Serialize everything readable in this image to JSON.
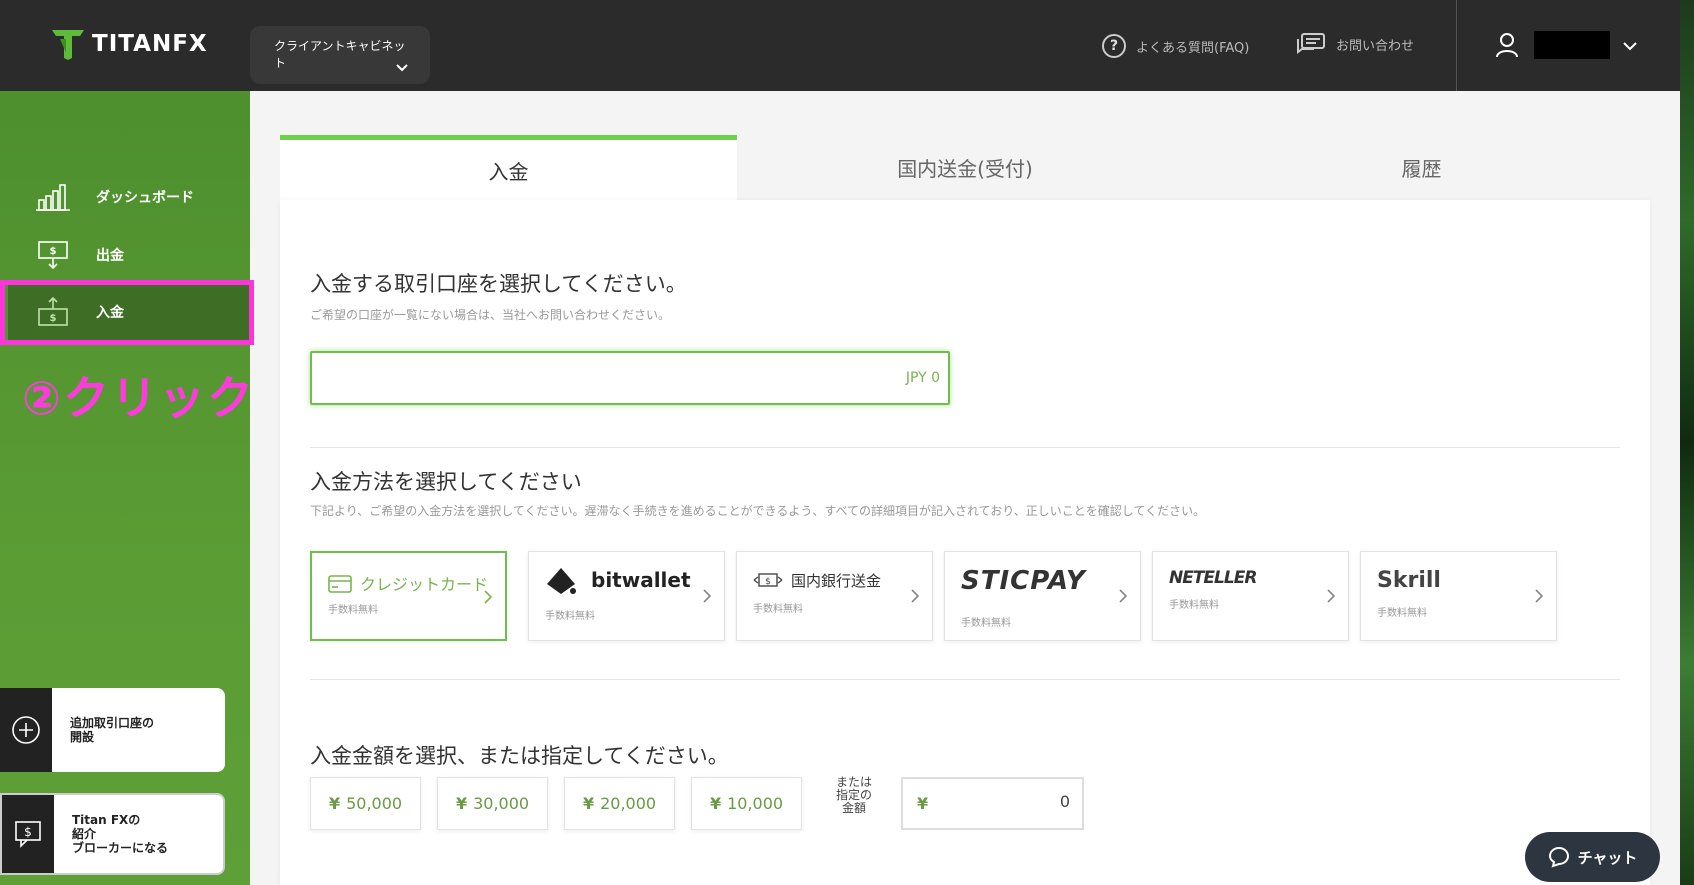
{
  "header": {
    "logo_text": "TITANFX",
    "cabinet_label": "クライアントキャビネット",
    "faq_label": "よくある質問(FAQ)",
    "contact_label": "お問い合わせ"
  },
  "sidebar": {
    "items": [
      {
        "label": "ダッシュボード",
        "icon": "bar-chart-icon"
      },
      {
        "label": "出金",
        "icon": "withdraw-icon"
      },
      {
        "label": "入金",
        "icon": "deposit-icon",
        "active": true
      }
    ],
    "annotation": "②クリック",
    "open_account_label": "追加取引口座の\n開設",
    "ib_label": "Titan FXの\n紹介\nブローカーになる"
  },
  "tabs": [
    {
      "label": "入金",
      "active": true
    },
    {
      "label": "国内送金(受付)"
    },
    {
      "label": "履歴"
    }
  ],
  "account_section": {
    "title": "入金する取引口座を選択してください。",
    "subtitle": "ご希望の口座が一覧にない場合は、当社へお問い合わせください。",
    "balance": "JPY 0"
  },
  "method_section": {
    "title": "入金方法を選択してください",
    "subtitle": "下記より、ご希望の入金方法を選択してください。遅滞なく手続きを進めることができるよう、すべての詳細項目が記入されており、正しいことを確認してください。",
    "methods": [
      {
        "name": "クレジットカード",
        "fee": "手数料無料"
      },
      {
        "name": "bitwallet",
        "fee": "手数料無料"
      },
      {
        "name": "国内銀行送金",
        "fee": "手数料無料"
      },
      {
        "name": "STICPAY",
        "fee": "手数料無料"
      },
      {
        "name": "NETELLER",
        "fee": "手数料無料"
      },
      {
        "name": "Skrill",
        "fee": "手数料無料"
      }
    ]
  },
  "amount_section": {
    "title": "入金金額を選択、または指定してください。",
    "currency_symbol": "¥",
    "presets": [
      "50,000",
      "30,000",
      "20,000",
      "10,000"
    ],
    "or_label": "または\n指定の\n金額",
    "custom_value": "0"
  },
  "chat": {
    "label": "チャット"
  },
  "colors": {
    "accent": "#6dbf4a",
    "sidebar": "#5b9c35",
    "highlight": "#ff33dd",
    "topbar": "#2b2b2b"
  }
}
